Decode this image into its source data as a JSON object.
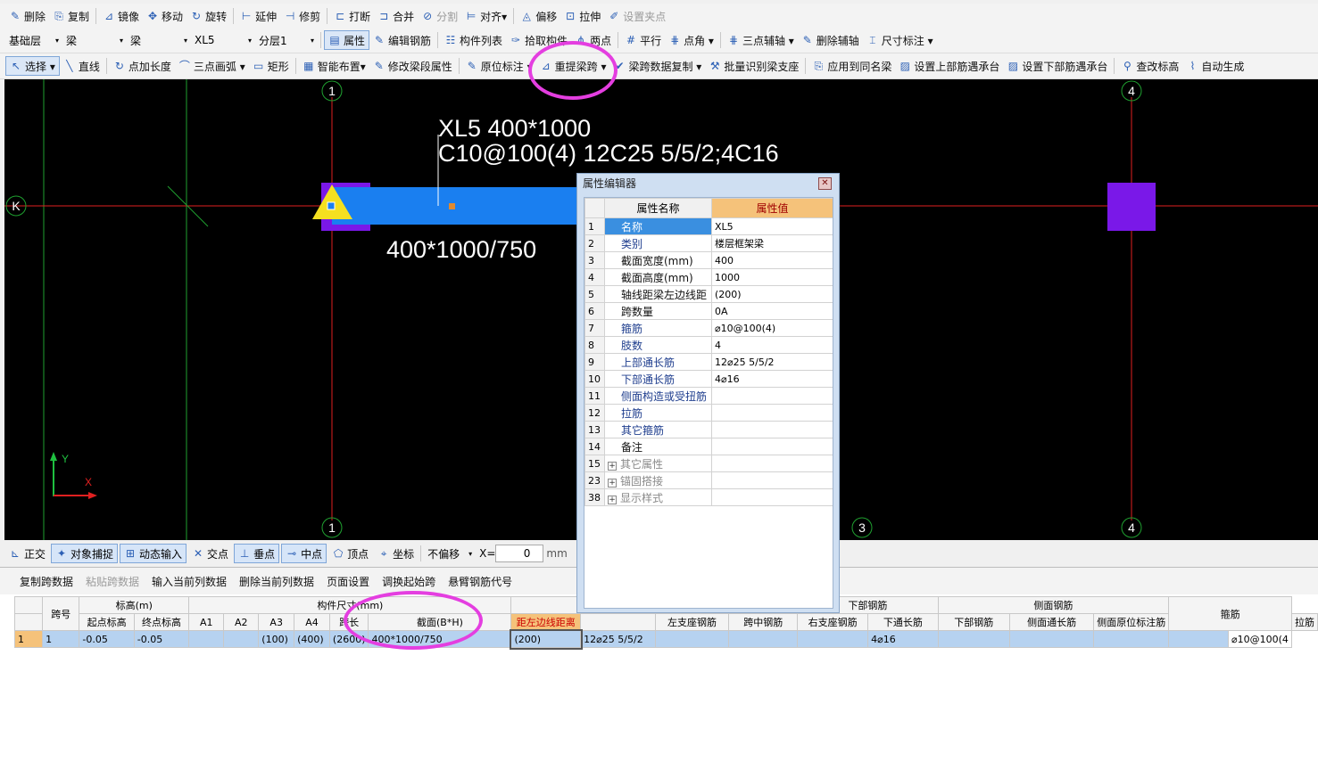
{
  "toolbar1": [
    {
      "icon": "✎",
      "label": "删除"
    },
    {
      "icon": "⎘",
      "label": "复制"
    },
    {
      "icon": "⊿",
      "label": "镜像"
    },
    {
      "icon": "✥",
      "label": "移动"
    },
    {
      "icon": "↻",
      "label": "旋转"
    },
    {
      "icon": "⊢",
      "label": "延伸"
    },
    {
      "icon": "⊣",
      "label": "修剪"
    },
    {
      "icon": "⊏",
      "label": "打断"
    },
    {
      "icon": "⊐",
      "label": "合并"
    },
    {
      "icon": "⊘",
      "label": "分割",
      "disabled": true
    },
    {
      "icon": "⊨",
      "label": "对齐▾"
    },
    {
      "icon": "◬",
      "label": "偏移"
    },
    {
      "icon": "⊡",
      "label": "拉伸"
    },
    {
      "icon": "✐",
      "label": "设置夹点",
      "disabled": true
    }
  ],
  "toolbar2": {
    "floor": "基础层",
    "type1": "梁",
    "type2": "梁",
    "name": "XL5",
    "layer": "分层1",
    "buttons": [
      {
        "icon": "▤",
        "label": "属性",
        "active": true
      },
      {
        "icon": "✎",
        "label": "编辑钢筋"
      },
      {
        "icon": "☷",
        "label": "构件列表"
      },
      {
        "icon": "✑",
        "label": "拾取构件"
      },
      {
        "icon": "⋔",
        "label": "两点"
      },
      {
        "icon": "#",
        "label": "平行"
      },
      {
        "icon": "⋕",
        "label": "点角 ▾"
      },
      {
        "icon": "⋕",
        "label": "三点辅轴 ▾"
      },
      {
        "icon": "✎",
        "label": "删除辅轴"
      },
      {
        "icon": "⌶",
        "label": "尺寸标注 ▾"
      }
    ]
  },
  "toolbar3": [
    {
      "icon": "↖",
      "label": "选择 ▾",
      "active": true
    },
    {
      "icon": "╲",
      "label": "直线"
    },
    {
      "icon": "↻",
      "label": "点加长度"
    },
    {
      "icon": "⌒",
      "label": "三点画弧 ▾"
    },
    {
      "icon": "▭",
      "label": "矩形"
    },
    {
      "icon": "▦",
      "label": "智能布置▾"
    },
    {
      "icon": "✎",
      "label": "修改梁段属性"
    },
    {
      "icon": "✎",
      "label": "原位标注 ▾"
    },
    {
      "icon": "⊿",
      "label": "重提梁跨 ▾"
    },
    {
      "icon": "✔",
      "label": "梁跨数据复制 ▾"
    },
    {
      "icon": "⚒",
      "label": "批量识别梁支座"
    },
    {
      "icon": "⎘",
      "label": "应用到同名梁"
    },
    {
      "icon": "▨",
      "label": "设置上部筋遇承台"
    },
    {
      "icon": "▨",
      "label": "设置下部筋遇承台"
    },
    {
      "icon": "⚲",
      "label": "查改标高"
    },
    {
      "icon": "⌇",
      "label": "自动生成"
    }
  ],
  "canvas": {
    "axis_top": [
      "1",
      "4"
    ],
    "axis_bottom": [
      "1",
      "3",
      "4"
    ],
    "axis_left": "K",
    "beam_label1": "XL5 400*1000",
    "beam_label2": "C10@100(4) 12C25 5/5/2;4C16",
    "beam_section": "400*1000/750",
    "ucs_y": "Y",
    "ucs_x": "X"
  },
  "statusbar": {
    "items": [
      {
        "icon": "⊾",
        "label": "正交"
      },
      {
        "icon": "✦",
        "label": "对象捕捉",
        "on": true
      },
      {
        "icon": "⊞",
        "label": "动态输入",
        "on": true
      },
      {
        "icon": "✕",
        "label": "交点"
      },
      {
        "icon": "⊥",
        "label": "垂点",
        "on": true
      },
      {
        "icon": "⊸",
        "label": "中点",
        "on": true
      },
      {
        "icon": "⬠",
        "label": "顶点"
      },
      {
        "icon": "⌖",
        "label": "坐标"
      }
    ],
    "offset": "不偏移",
    "x_label": "X=",
    "x_value": "0",
    "unit": "mm"
  },
  "bottom_panel": {
    "buttons": [
      "复制跨数据",
      "粘贴跨数据",
      "输入当前列数据",
      "删除当前列数据",
      "页面设置",
      "调换起始跨",
      "悬臂钢筋代号"
    ],
    "group_headers": {
      "kuahao": "跨号",
      "biaogao": "标高(m)",
      "gouj": "构件尺寸(mm)",
      "xiabu": "下部钢筋",
      "cemian": "侧面钢筋",
      "gujin": "箍筋"
    },
    "col_headers": [
      "起点标高",
      "终点标高",
      "A1",
      "A2",
      "A3",
      "A4",
      "跨长",
      "截面(B*H)",
      "距左边线距离",
      "",
      "左支座钢筋",
      "跨中钢筋",
      "右支座钢筋",
      "下通长筋",
      "下部钢筋",
      "侧面通长筋",
      "侧面原位标注筋",
      "拉筋"
    ],
    "row": [
      "1",
      "1",
      "-0.05",
      "-0.05",
      "",
      "",
      "(100)",
      "(400)",
      "(2600)",
      "400*1000/750",
      "(200)",
      "12⌀25 5/5/2",
      "",
      "",
      "",
      "4⌀16",
      "",
      "",
      "",
      "",
      "⌀10@100(4"
    ]
  },
  "property_editor": {
    "title": "属性编辑器",
    "col_name": "属性名称",
    "col_value": "属性值",
    "rows": [
      {
        "n": "1",
        "name": "名称",
        "value": "XL5",
        "style": "blue",
        "sel": true
      },
      {
        "n": "2",
        "name": "类别",
        "value": "楼层框架梁",
        "style": "blue"
      },
      {
        "n": "3",
        "name": "截面宽度(mm)",
        "value": "400",
        "style": "black"
      },
      {
        "n": "4",
        "name": "截面高度(mm)",
        "value": "1000",
        "style": "black"
      },
      {
        "n": "5",
        "name": "轴线距梁左边线距",
        "value": "(200)",
        "style": "black"
      },
      {
        "n": "6",
        "name": "跨数量",
        "value": "0A",
        "style": "black"
      },
      {
        "n": "7",
        "name": "箍筋",
        "value": "⌀10@100(4)",
        "style": "blue"
      },
      {
        "n": "8",
        "name": "肢数",
        "value": "4",
        "style": "blue"
      },
      {
        "n": "9",
        "name": "上部通长筋",
        "value": "12⌀25 5/5/2",
        "style": "blue"
      },
      {
        "n": "10",
        "name": "下部通长筋",
        "value": "4⌀16",
        "style": "blue"
      },
      {
        "n": "11",
        "name": "侧面构造或受扭筋",
        "value": "",
        "style": "blue"
      },
      {
        "n": "12",
        "name": "拉筋",
        "value": "",
        "style": "blue"
      },
      {
        "n": "13",
        "name": "其它箍筋",
        "value": "",
        "style": "blue"
      },
      {
        "n": "14",
        "name": "备注",
        "value": "",
        "style": "black"
      },
      {
        "n": "15",
        "name": "其它属性",
        "value": "",
        "style": "grey",
        "plus": true
      },
      {
        "n": "23",
        "name": "锚固搭接",
        "value": "",
        "style": "grey",
        "plus": true
      },
      {
        "n": "38",
        "name": "显示样式",
        "value": "",
        "style": "grey",
        "plus": true
      }
    ]
  },
  "colors": {
    "canvas_bg": "#000000",
    "beam": "#1a7ff0",
    "column": "#7a18e8",
    "axis": "#e02020",
    "highlight": "#e43ee0",
    "marker": "#f5e020"
  }
}
